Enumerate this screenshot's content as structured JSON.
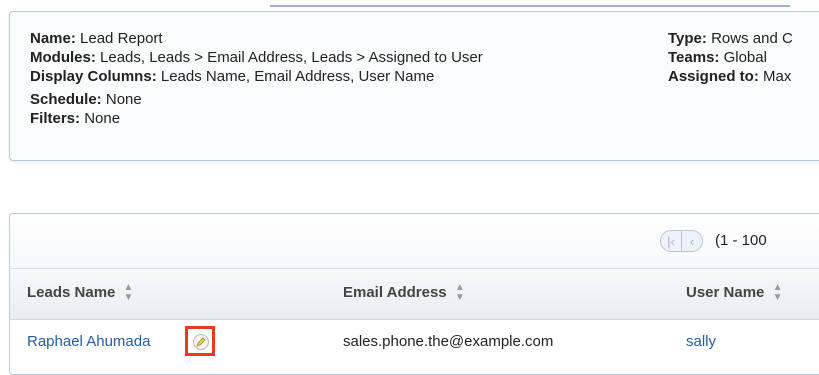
{
  "summary": {
    "left": {
      "name_label": "Name:",
      "name_value": "Lead Report",
      "modules_label": "Modules:",
      "modules_value": "Leads, Leads > Email Address, Leads > Assigned to User",
      "display_label": "Display Columns:",
      "display_value": "Leads Name, Email Address, User Name",
      "schedule_label": "Schedule:",
      "schedule_value": "None",
      "filters_label": "Filters:",
      "filters_value": "None"
    },
    "right": {
      "type_label": "Type:",
      "type_value": "Rows and C",
      "teams_label": "Teams:",
      "teams_value": "Global",
      "assigned_label": "Assigned to:",
      "assigned_value": "Max"
    }
  },
  "pager": {
    "first_icon": "first-page-icon",
    "prev_icon": "prev-page-icon",
    "range_text": "(1 - 100"
  },
  "table": {
    "columns": [
      "Leads Name",
      "Email Address",
      "User Name"
    ],
    "rows": [
      {
        "leads_name": "Raphael Ahumada",
        "email": "sales.phone.the@example.com",
        "user": "sally"
      }
    ]
  },
  "colors": {
    "link": "#1f5fa8",
    "highlight_border": "#e53c1a",
    "panel_border": "#b9cbe0"
  }
}
